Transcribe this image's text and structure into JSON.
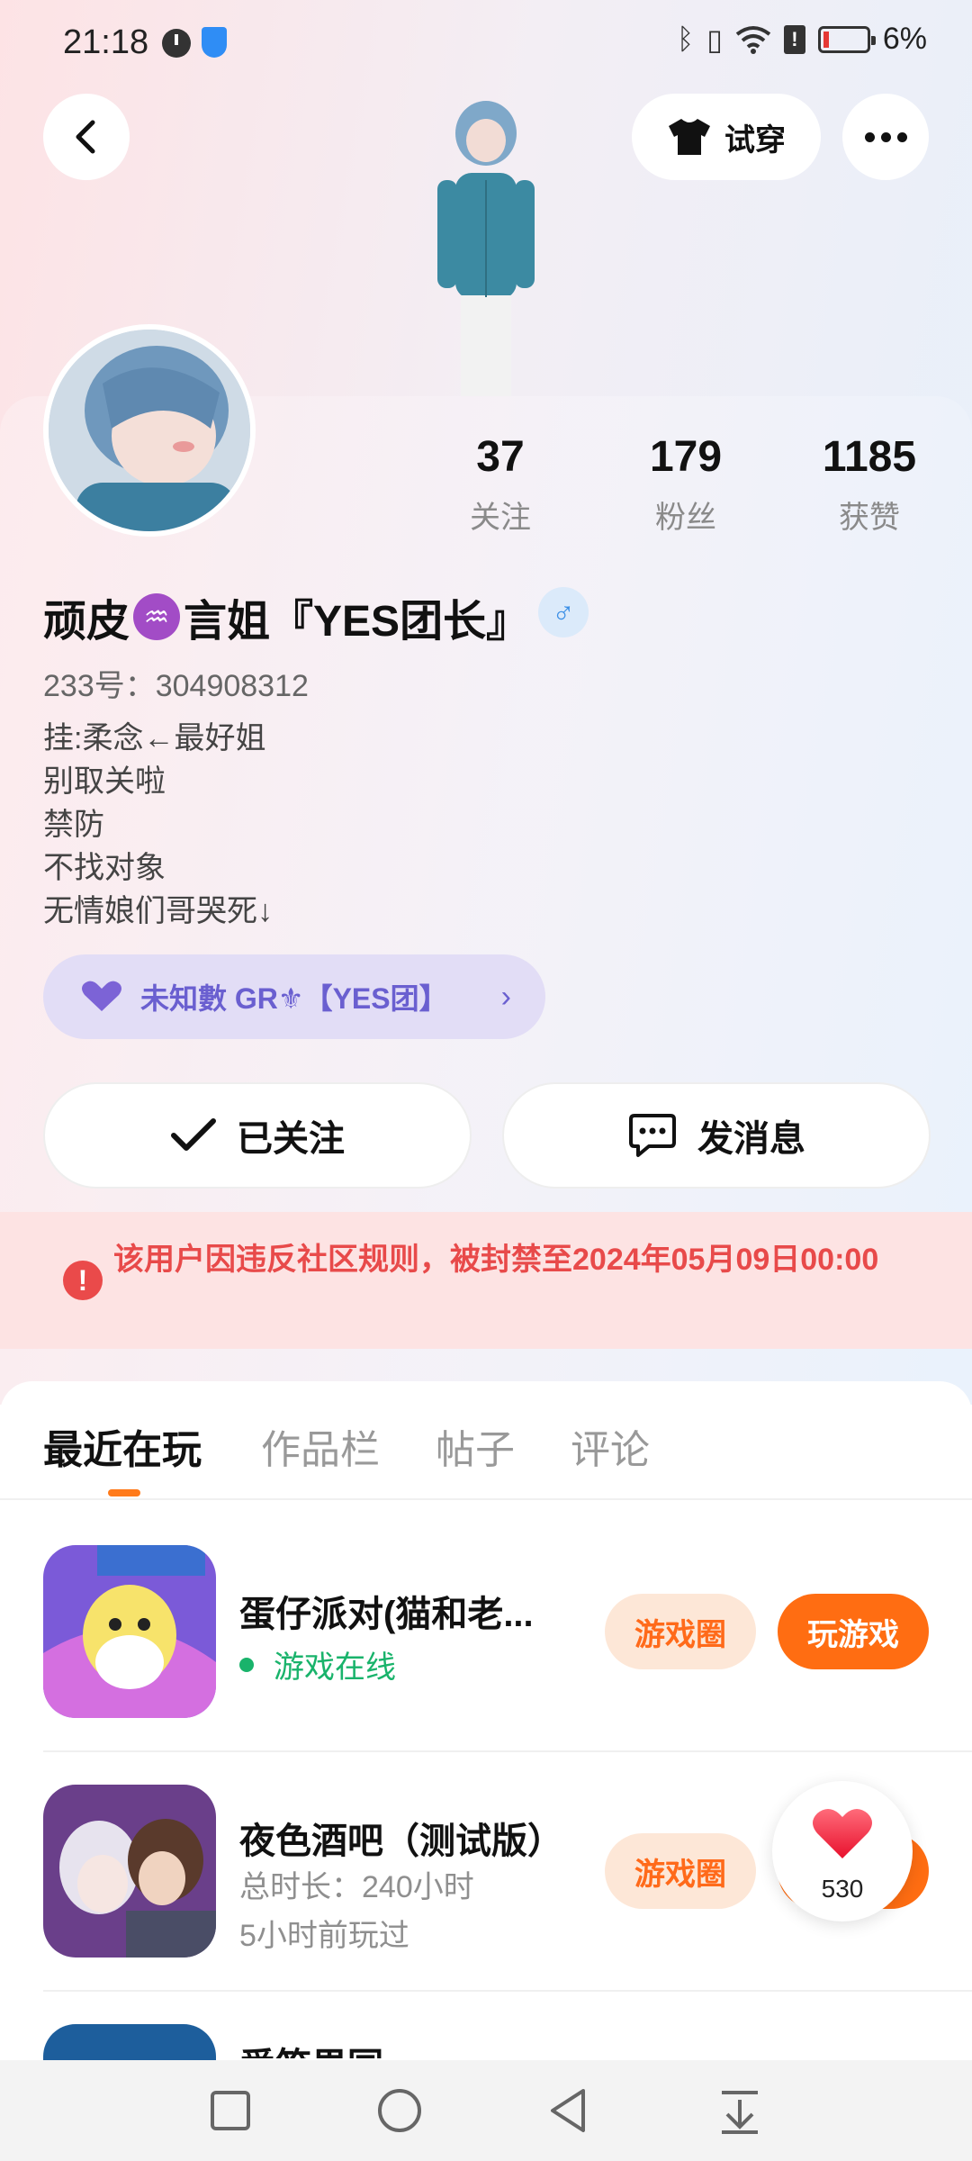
{
  "status": {
    "time": "21:18",
    "battery": "6%"
  },
  "header": {
    "tryon_label": "试穿"
  },
  "profile": {
    "stats": [
      {
        "value": "37",
        "label": "关注"
      },
      {
        "value": "179",
        "label": "粉丝"
      },
      {
        "value": "1185",
        "label": "获赞"
      }
    ],
    "name_part1": "顽皮",
    "zodiac_glyph": "♒",
    "name_part2": "言姐『YES团长』",
    "gender_glyph": "♂",
    "uid": "233号：304908312",
    "bio": [
      "挂:柔念←最好姐",
      "别取关啦",
      "禁防",
      "不找对象",
      "无情娘们哥哭死↓"
    ],
    "group_label": "未知數 GR⚜【YES团】"
  },
  "actions": {
    "followed_label": "已关注",
    "message_label": "发消息"
  },
  "ban": {
    "text": "该用户因违反社区规则，被封禁至2024年05月09日00:00"
  },
  "tabs": [
    "最近在玩",
    "作品栏",
    "帖子",
    "评论"
  ],
  "games": [
    {
      "title": "蛋仔派对(猫和老...",
      "status": "游戏在线",
      "circle_label": "游戏圈",
      "play_label": "玩游戏"
    },
    {
      "title": "夜色酒吧（测试版）",
      "duration": "总时长：240小时",
      "last_played": "5小时前玩过",
      "circle_label": "游戏圈"
    },
    {
      "title": "爱笑果园"
    }
  ],
  "like": {
    "count": "530"
  },
  "colors": {
    "accent": "#ff6d12",
    "online": "#19b36b",
    "ban": "#e84a4a"
  }
}
